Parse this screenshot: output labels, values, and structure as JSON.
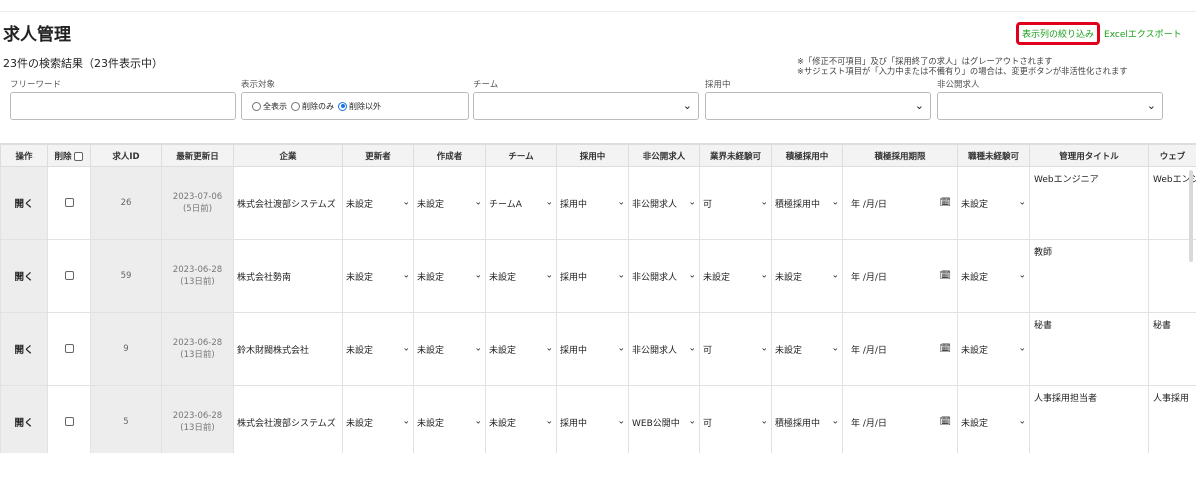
{
  "page": {
    "title": "求人管理",
    "result_text": "23件の検索結果（23件表示中）",
    "filter_columns_link": "表示列の絞り込み",
    "excel_export_link": "Excelエクスポート",
    "notes": [
      "※「修正不可項目」及び「採用終了の求人」はグレーアウトされます",
      "※サジェスト項目が「入力中または不備有り」の場合は、変更ボタンが非活性化されます"
    ]
  },
  "filters": {
    "freeword_label": "フリーワード",
    "freeword_value": "",
    "display_label": "表示対象",
    "display_options": [
      "全表示",
      "削除のみ",
      "削除以外"
    ],
    "display_selected": "削除以外",
    "team_label": "チーム",
    "team_value": "",
    "hiring_label": "採用中",
    "hiring_value": "",
    "private_label": "非公開求人",
    "private_value": ""
  },
  "table": {
    "headers": [
      "操作",
      "削除",
      "求人ID",
      "最新更新日",
      "企業",
      "更新者",
      "作成者",
      "チーム",
      "採用中",
      "非公開求人",
      "業界未経験可",
      "積極採用中",
      "積極採用期限",
      "職種未経験可",
      "管理用タイトル",
      "ウェブ"
    ],
    "rows": [
      {
        "action": "開く",
        "id": "26",
        "date": "2023-07-06",
        "ago": "(5日前)",
        "company": "株式会社渡部システムズ",
        "updater": "未設定",
        "creator": "未設定",
        "team": "チームA",
        "hiring": "採用中",
        "private": "非公開求人",
        "industry": "可",
        "active": "積極採用中",
        "deadline": "年 /月/日",
        "job": "未設定",
        "mgmt_title": "Webエンジニア",
        "web": "Webエンジ"
      },
      {
        "action": "開く",
        "id": "59",
        "date": "2023-06-28",
        "ago": "(13日前)",
        "company": "株式会社勢南",
        "updater": "未設定",
        "creator": "未設定",
        "team": "未設定",
        "hiring": "採用中",
        "private": "非公開求人",
        "industry": "未設定",
        "active": "未設定",
        "deadline": "年 /月/日",
        "job": "未設定",
        "mgmt_title": "教師",
        "web": ""
      },
      {
        "action": "開く",
        "id": "9",
        "date": "2023-06-28",
        "ago": "(13日前)",
        "company": "鈴木財閥株式会社",
        "updater": "未設定",
        "creator": "未設定",
        "team": "未設定",
        "hiring": "採用中",
        "private": "非公開求人",
        "industry": "可",
        "active": "未設定",
        "deadline": "年 /月/日",
        "job": "未設定",
        "mgmt_title": "秘書",
        "web": "秘書"
      },
      {
        "action": "開く",
        "id": "5",
        "date": "2023-06-28",
        "ago": "(13日前)",
        "company": "株式会社渡部システムズ",
        "updater": "未設定",
        "creator": "未設定",
        "team": "未設定",
        "hiring": "採用中",
        "private": "WEB公開中",
        "industry": "可",
        "active": "積極採用中",
        "deadline": "年 /月/日",
        "job": "未設定",
        "mgmt_title": "人事採用担当者",
        "web": "人事採用"
      }
    ]
  }
}
